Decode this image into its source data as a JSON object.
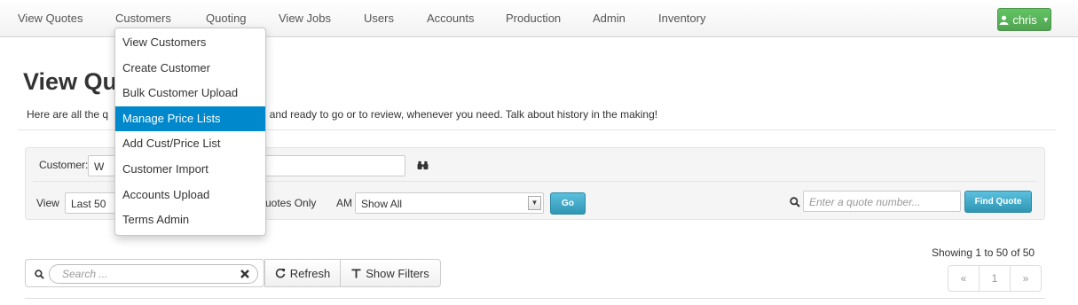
{
  "nav": {
    "items": [
      "View Quotes",
      "Customers",
      "Quoting",
      "View Jobs",
      "Users",
      "Accounts",
      "Production",
      "Admin",
      "Inventory"
    ],
    "user": "chris"
  },
  "customers_menu": {
    "items": [
      "View Customers",
      "Create Customer",
      "Bulk Customer Upload",
      "Manage Price Lists",
      "Add Cust/Price List",
      "Customer Import",
      "Accounts Upload",
      "Terms Admin"
    ],
    "active_index": 3
  },
  "page": {
    "title": "View Qu",
    "intro_left": "Here are all the q",
    "intro_right": "ed and ready to go or to review, whenever you need. Talk about history in the making!"
  },
  "filters": {
    "customer_label": "Customer:",
    "customer_value": "W",
    "view_label": "View",
    "view_value": "Last 50",
    "quotes_only_label": "uotes Only",
    "am_label": "AM",
    "am_value": "Show All",
    "go_label": "Go",
    "quote_search_placeholder": "Enter a quote number...",
    "find_quote_label": "Find Quote"
  },
  "table_toolbar": {
    "search_placeholder": "Search ...",
    "refresh_label": "Refresh",
    "show_filters_label": "Show Filters",
    "showing_text": "Showing 1 to 50 of 50",
    "pager": [
      "«",
      "1",
      "»"
    ]
  },
  "colors": {
    "user_button": "#51a351",
    "menu_active": "#0088cc",
    "find_button": "#2f96b4"
  }
}
